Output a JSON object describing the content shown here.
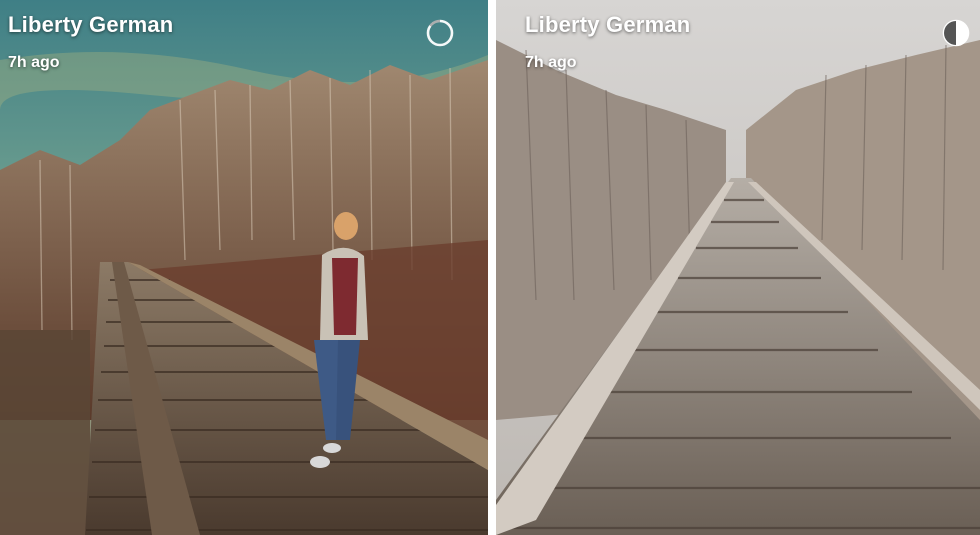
{
  "stories": [
    {
      "username": "Liberty German",
      "time_ago": "7h ago",
      "timer_icon": "countdown-timer-icon",
      "timer_remaining": 0.85
    },
    {
      "username": "Liberty German",
      "time_ago": "7h ago",
      "timer_icon": "countdown-timer-icon",
      "timer_remaining": 0.5
    }
  ]
}
